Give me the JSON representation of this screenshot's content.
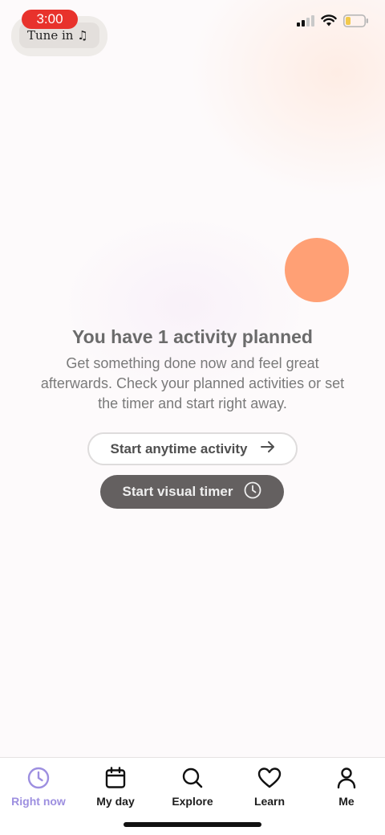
{
  "status_bar": {
    "time": "3:00",
    "now_playing": "Tune in ♫"
  },
  "main": {
    "title": "You have 1 activity planned",
    "subtitle": "Get something done now and feel great afterwards. Check your planned activities or set the timer and start right away.",
    "primary_button_label": "Start anytime activity",
    "secondary_button_label": "Start visual timer"
  },
  "tabs": [
    {
      "label": "Right now",
      "icon": "clock-icon",
      "active": true
    },
    {
      "label": "My day",
      "icon": "calendar-icon",
      "active": false
    },
    {
      "label": "Explore",
      "icon": "search-icon",
      "active": false
    },
    {
      "label": "Learn",
      "icon": "heart-icon",
      "active": false
    },
    {
      "label": "Me",
      "icon": "person-icon",
      "active": false
    }
  ],
  "colors": {
    "accent": "#9d8fe0",
    "orange_dot": "#ffa075",
    "dark_button": "#646060",
    "recording_pill": "#e8322c"
  }
}
